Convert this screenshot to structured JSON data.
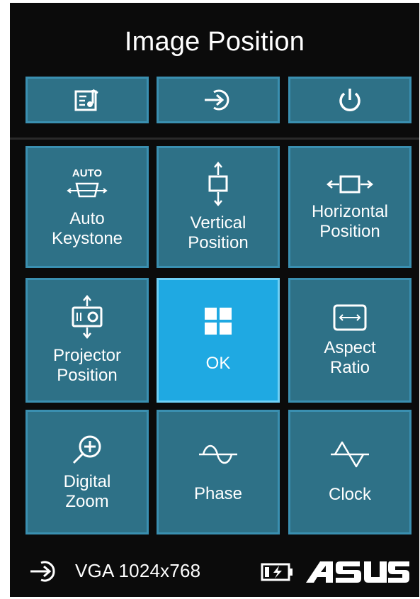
{
  "header": {
    "title": "Image Position"
  },
  "top_buttons": [
    {
      "name": "media-button",
      "icon": "music-note-book-icon"
    },
    {
      "name": "source-button",
      "icon": "input-source-icon"
    },
    {
      "name": "power-button",
      "icon": "power-icon"
    }
  ],
  "grid": {
    "auto_keystone": {
      "icon_text": "AUTO",
      "label": "Auto\nKeystone"
    },
    "vertical_position": {
      "label": "Vertical\nPosition"
    },
    "horizontal_position": {
      "label": "Horizontal\nPosition"
    },
    "projector_position": {
      "label": "Projector\nPosition"
    },
    "ok": {
      "label": "OK"
    },
    "aspect_ratio": {
      "label": "Aspect\nRatio"
    },
    "digital_zoom": {
      "label": "Digital\nZoom"
    },
    "phase": {
      "label": "Phase"
    },
    "clock": {
      "label": "Clock"
    }
  },
  "status_bar": {
    "source": "VGA 1024x768",
    "brand": "ASUS"
  },
  "colors": {
    "tile": "#2e7187",
    "tile_border": "#3a8fb0",
    "active_tile": "#1fa9e2",
    "background": "#0b0b0b"
  }
}
